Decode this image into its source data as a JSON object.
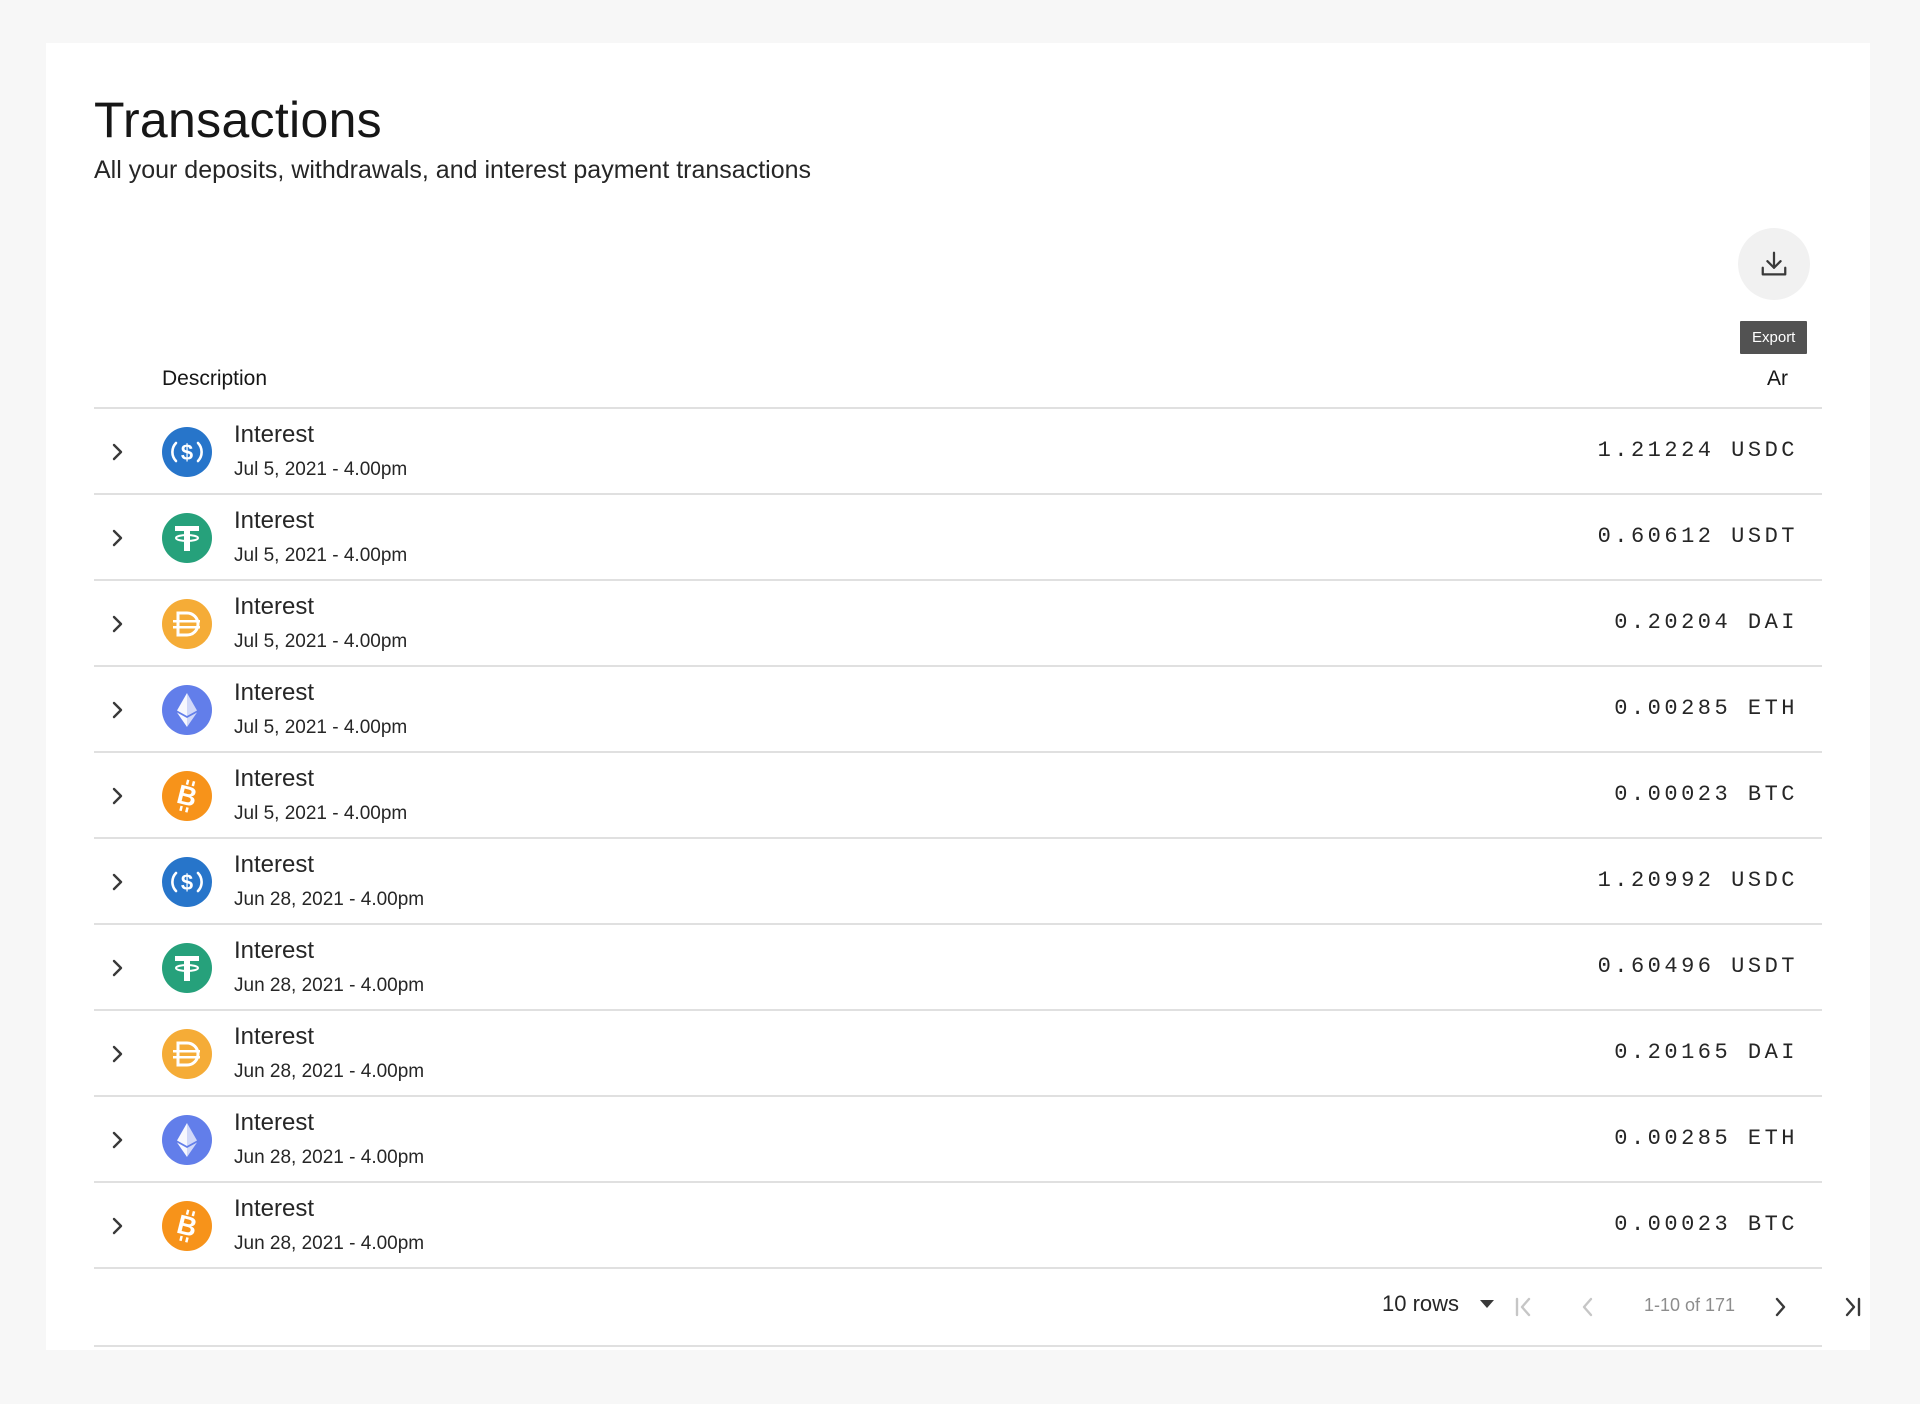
{
  "header": {
    "title": "Transactions",
    "subtitle": "All your deposits, withdrawals, and interest payment transactions"
  },
  "toolbar": {
    "export_icon": "download-icon",
    "export_tooltip": "Export"
  },
  "table": {
    "columns": [
      "Description",
      "Ar"
    ],
    "rows": [
      {
        "title": "Interest",
        "date": "Jul 5, 2021 - 4.00pm",
        "amount": "1.21224 USDC",
        "coin": "usdc"
      },
      {
        "title": "Interest",
        "date": "Jul 5, 2021 - 4.00pm",
        "amount": "0.60612 USDT",
        "coin": "usdt"
      },
      {
        "title": "Interest",
        "date": "Jul 5, 2021 - 4.00pm",
        "amount": "0.20204 DAI",
        "coin": "dai"
      },
      {
        "title": "Interest",
        "date": "Jul 5, 2021 - 4.00pm",
        "amount": "0.00285 ETH",
        "coin": "eth"
      },
      {
        "title": "Interest",
        "date": "Jul 5, 2021 - 4.00pm",
        "amount": "0.00023 BTC",
        "coin": "btc"
      },
      {
        "title": "Interest",
        "date": "Jun 28, 2021 - 4.00pm",
        "amount": "1.20992 USDC",
        "coin": "usdc"
      },
      {
        "title": "Interest",
        "date": "Jun 28, 2021 - 4.00pm",
        "amount": "0.60496 USDT",
        "coin": "usdt"
      },
      {
        "title": "Interest",
        "date": "Jun 28, 2021 - 4.00pm",
        "amount": "0.20165 DAI",
        "coin": "dai"
      },
      {
        "title": "Interest",
        "date": "Jun 28, 2021 - 4.00pm",
        "amount": "0.00285 ETH",
        "coin": "eth"
      },
      {
        "title": "Interest",
        "date": "Jun 28, 2021 - 4.00pm",
        "amount": "0.00023 BTC",
        "coin": "btc"
      }
    ]
  },
  "pagination": {
    "rows_label": "10 rows",
    "range_label": "1-10 of 171"
  },
  "colors": {
    "usdc": "#2775ca",
    "usdt": "#26a17b",
    "dai": "#f5ac37",
    "eth": "#627eea",
    "btc": "#f7931a"
  }
}
